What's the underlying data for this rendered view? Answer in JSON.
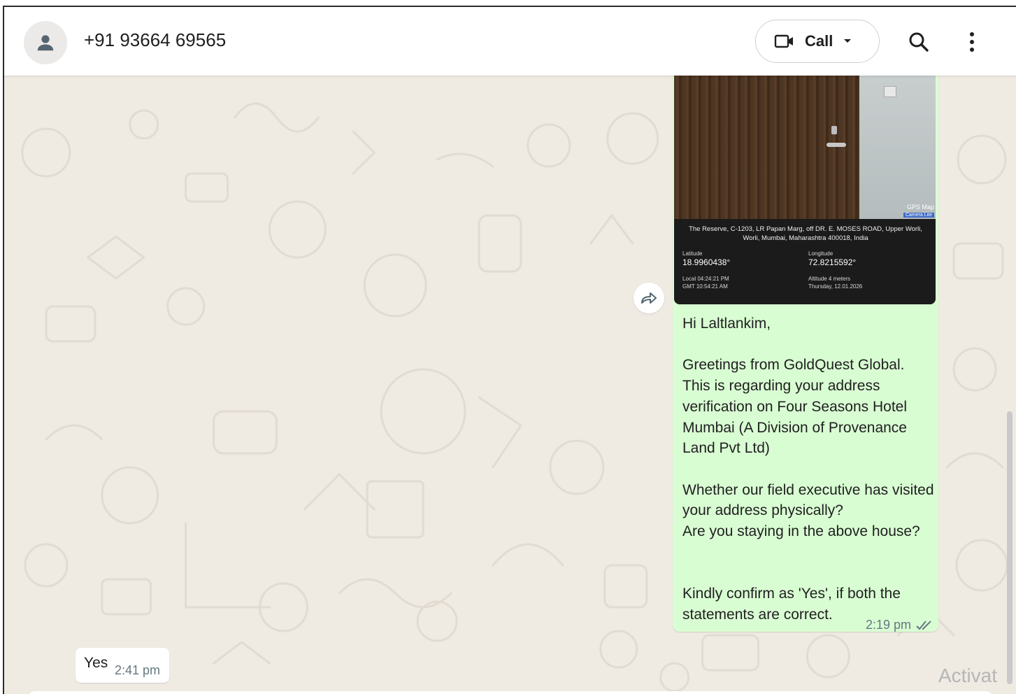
{
  "header": {
    "contact_name": "+91 93664 69565",
    "call_label": "Call"
  },
  "outgoing_message": {
    "photo_overlay": {
      "brand": "GPS Map",
      "brand_tag": "Camera Lite",
      "address": "The Reserve, C-1203, LR Papan Marg, off DR. E. MOSES ROAD, Upper Worli, Worli, Mumbai, Maharashtra 400018, India",
      "latitude_label": "Latitude",
      "latitude_value": "18.9960438°",
      "longitude_label": "Longitude",
      "longitude_value": "72.8215592°",
      "local_time": "Local 04:24:21 PM",
      "gmt_time": "GMT 10:54:21 AM",
      "altitude": "Altitude 4 meters",
      "date": "Thursday, 12.01.2026"
    },
    "text": "Hi Laltlankim,\n\nGreetings from GoldQuest Global. This is regarding your address verification on Four Seasons Hotel Mumbai (A Division of Provenance Land Pvt Ltd)\n\nWhether our field executive has visited your address physically?\nAre you staying in the above house?\n\n\nKindly confirm as 'Yes', if both the statements are correct.",
    "time": "2:19 pm"
  },
  "incoming_message": {
    "text": "Yes",
    "time": "2:41 pm"
  },
  "watermark": "Activat",
  "colors": {
    "outgoing_bubble": "#d9fdd3",
    "chat_background": "#efeae2",
    "read_ticks": "#667781"
  }
}
